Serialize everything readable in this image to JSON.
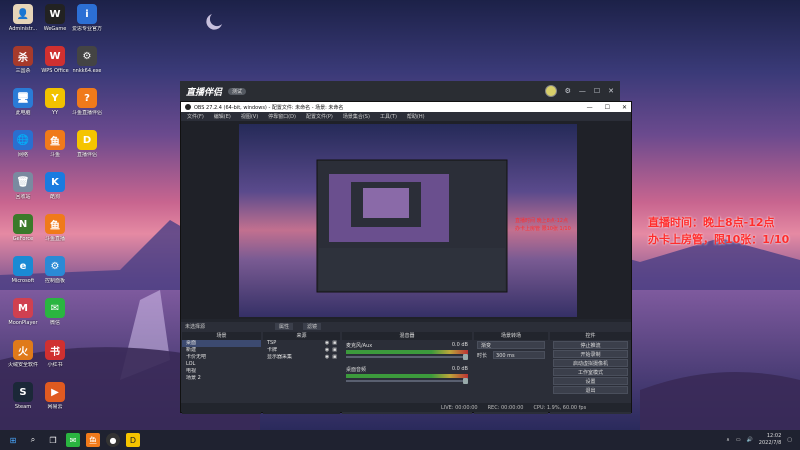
{
  "desktop_icons": [
    {
      "label": "Administr...",
      "color": "#e6d5b8",
      "glyph": "👤",
      "icon": "user-folder-icon"
    },
    {
      "label": "WeGame",
      "color": "#222",
      "glyph": "W",
      "icon": "wegame-icon"
    },
    {
      "label": "爱思专业官方\n网版平台",
      "color": "#2c6fd4",
      "glyph": "i",
      "icon": "i4-icon"
    },
    {
      "label": "三国杀",
      "color": "#a73a2b",
      "glyph": "杀",
      "icon": "sanguosha-icon"
    },
    {
      "label": "WPS Office",
      "color": "#d03030",
      "glyph": "W",
      "icon": "wps-icon"
    },
    {
      "label": "nnkk64.exe\n中国发行",
      "color": "#444",
      "glyph": "⚙",
      "icon": "exe-icon"
    },
    {
      "label": "此电脑",
      "color": "#2a7bd6",
      "glyph": "🖥",
      "icon": "this-pc-icon"
    },
    {
      "label": "YY",
      "color": "#f2c200",
      "glyph": "Y",
      "icon": "yy-icon"
    },
    {
      "label": "斗鱼直播伴侣",
      "color": "#f07a1a",
      "glyph": "?",
      "icon": "douyu-icon"
    },
    {
      "label": "网络",
      "color": "#2a6fd0",
      "glyph": "🌐",
      "icon": "network-icon"
    },
    {
      "label": "斗鱼",
      "color": "#f07a1a",
      "glyph": "鱼",
      "icon": "douyu-app-icon"
    },
    {
      "label": "直播伴侣",
      "color": "#f5c400",
      "glyph": "D",
      "icon": "live-companion-icon"
    },
    {
      "label": "回收站",
      "color": "#7a8aa0",
      "glyph": "🗑",
      "icon": "recycle-bin-icon"
    },
    {
      "label": "酷狗",
      "color": "#1a7be0",
      "glyph": "K",
      "icon": "kugou-icon"
    },
    {
      "label": "",
      "color": "",
      "glyph": "",
      "icon": ""
    },
    {
      "label": "GeForce\nExperience",
      "color": "#3a7a2a",
      "glyph": "N",
      "icon": "nvidia-icon"
    },
    {
      "label": "斗鱼直播",
      "color": "#f07a1a",
      "glyph": "鱼",
      "icon": "douyu-live-icon"
    },
    {
      "label": "",
      "color": "",
      "glyph": "",
      "icon": ""
    },
    {
      "label": "Microsoft\nEdge",
      "color": "#1a8ad4",
      "glyph": "e",
      "icon": "edge-icon"
    },
    {
      "label": "控制面板",
      "color": "#2a8ad6",
      "glyph": "⚙",
      "icon": "control-panel-icon"
    },
    {
      "label": "",
      "color": "",
      "glyph": "",
      "icon": ""
    },
    {
      "label": "MoonPlayer",
      "color": "#d04050",
      "glyph": "M",
      "icon": "moon-player-icon"
    },
    {
      "label": "微信",
      "color": "#2ab540",
      "glyph": "✉",
      "icon": "wechat-icon"
    },
    {
      "label": "",
      "color": "",
      "glyph": "",
      "icon": ""
    },
    {
      "label": "火绒安全软件",
      "color": "#e07a1a",
      "glyph": "火",
      "icon": "huorong-icon"
    },
    {
      "label": "小红书",
      "color": "#d03030",
      "glyph": "书",
      "icon": "xhs-icon"
    },
    {
      "label": "",
      "color": "",
      "glyph": "",
      "icon": ""
    },
    {
      "label": "Steam",
      "color": "#1b2838",
      "glyph": "S",
      "icon": "steam-icon"
    },
    {
      "label": "网易云",
      "color": "#e05a20",
      "glyph": "▶",
      "icon": "netease-icon"
    }
  ],
  "overlay": {
    "line1": "直播时间：晚上8点-12点",
    "line2": "办卡上房管，限10张：1/10"
  },
  "live_companion": {
    "logo": "直播伴侣",
    "badge": "测试"
  },
  "obs": {
    "title": "OBS 27.2.4 (64-bit, windows) - 配置文件: 未命名 - 场景: 未命名",
    "menu": [
      "文件(F)",
      "编辑(E)",
      "视图(V)",
      "停靠窗口(D)",
      "配置文件(P)",
      "场景集合(S)",
      "工具(T)",
      "帮助(H)"
    ],
    "source_bar": {
      "label": "未选择源",
      "props": "属性",
      "filters": "滤镜"
    },
    "scenes": {
      "header": "场景",
      "items": [
        "桌面",
        "新建",
        "卡价无吧",
        "LOL",
        "电视",
        "场景 2"
      ]
    },
    "sources": {
      "header": "来源",
      "items": [
        "TSP",
        "卡牌",
        "显示器采集"
      ]
    },
    "mixer": {
      "header": "混音器",
      "ch1": "麦克风/Aux",
      "ch2": "桌面音频",
      "db1": "0.0 dB",
      "db2": "0.0 dB"
    },
    "transitions": {
      "header": "场景转场",
      "type": "渐变",
      "duration_label": "时长",
      "duration": "300 ms"
    },
    "controls": {
      "header": "控件",
      "buttons": [
        "停止推流",
        "开始录制",
        "启动虚拟摄像机",
        "工作室模式",
        "设置",
        "退出"
      ]
    },
    "status": {
      "live": "LIVE: 00:00:00",
      "rec": "REC: 00:00:00",
      "cpu": "CPU: 1.9%, 60.00 fps"
    }
  },
  "taskbar": {
    "time": "12:02",
    "date": "2022/7/8"
  }
}
